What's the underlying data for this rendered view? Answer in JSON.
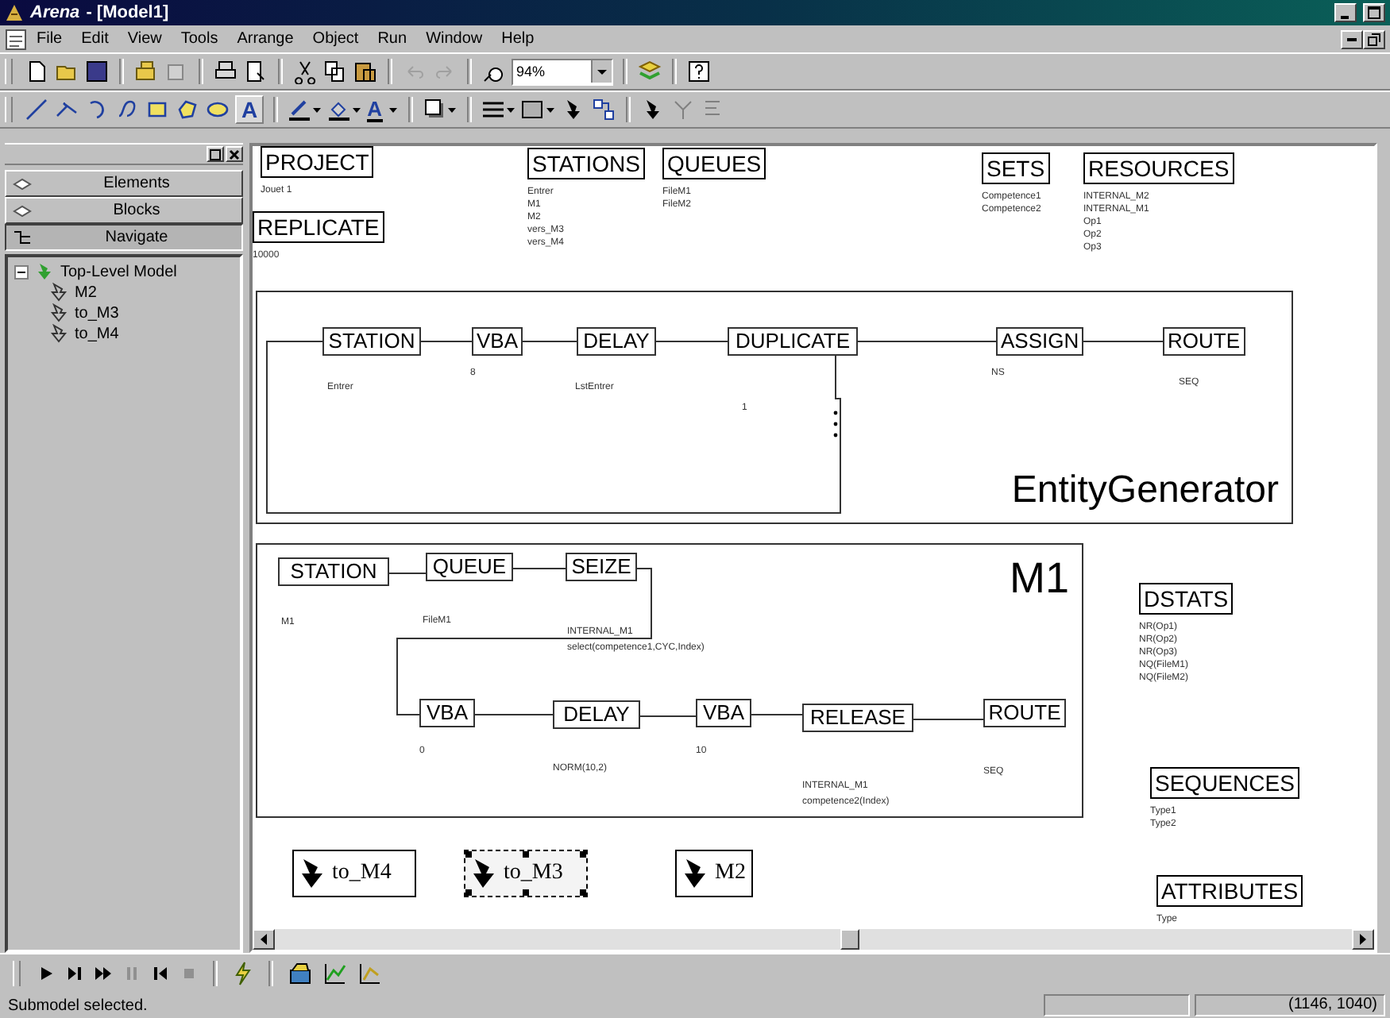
{
  "window": {
    "title": "Arena",
    "document": "- [Model1]"
  },
  "menu": [
    "File",
    "Edit",
    "View",
    "Tools",
    "Arrange",
    "Object",
    "Run",
    "Window",
    "Help"
  ],
  "toolbar": {
    "zoom": "94%"
  },
  "drawing_toolbar": {
    "text_tool": "A",
    "font_color": "A"
  },
  "project_bar": {
    "tabs": [
      {
        "label": "Elements",
        "selected": false
      },
      {
        "label": "Blocks",
        "selected": false
      },
      {
        "label": "Navigate",
        "selected": true
      }
    ],
    "tree": [
      {
        "label": "Top-Level Model",
        "expanded": true,
        "children": [
          {
            "label": "M2"
          },
          {
            "label": "to_M3"
          },
          {
            "label": "to_M4"
          }
        ]
      }
    ]
  },
  "data_modules": [
    {
      "title": "PROJECT",
      "items": [
        "Jouet 1"
      ]
    },
    {
      "title": "REPLICATE",
      "items": [
        "10000"
      ]
    },
    {
      "title": "STATIONS",
      "items": [
        "Entrer",
        "M1",
        "M2",
        "vers_M3",
        "vers_M4"
      ]
    },
    {
      "title": "QUEUES",
      "items": [
        "FileM1",
        "FileM2"
      ]
    },
    {
      "title": "SETS",
      "items": [
        "Competence1",
        "Competence2"
      ]
    },
    {
      "title": "RESOURCES",
      "items": [
        "INTERNAL_M2",
        "INTERNAL_M1",
        "Op1",
        "Op2",
        "Op3"
      ]
    },
    {
      "title": "DSTATS",
      "items": [
        "NR(Op1)",
        "NR(Op2)",
        "NR(Op3)",
        "NQ(FileM1)",
        "NQ(FileM2)"
      ]
    },
    {
      "title": "SEQUENCES",
      "items": [
        "Type1",
        "Type2"
      ]
    },
    {
      "title": "ATTRIBUTES",
      "items": [
        "Type"
      ]
    }
  ],
  "submodels": [
    {
      "title": "EntityGenerator",
      "modules": [
        {
          "label": "STATION",
          "operands": [
            "Entrer"
          ]
        },
        {
          "label": "VBA",
          "operands": [
            "8"
          ]
        },
        {
          "label": "DELAY",
          "operands": [
            "LstEntrer"
          ]
        },
        {
          "label": "DUPLICATE",
          "operands": [
            "1"
          ]
        },
        {
          "label": "ASSIGN",
          "operands": [
            "NS"
          ]
        },
        {
          "label": "ROUTE",
          "operands": [
            "SEQ"
          ]
        }
      ]
    },
    {
      "title": "M1",
      "modules": [
        {
          "label": "STATION",
          "operands": [
            "M1"
          ]
        },
        {
          "label": "QUEUE",
          "operands": [
            "FileM1"
          ]
        },
        {
          "label": "SEIZE",
          "operands": [
            "INTERNAL_M1",
            "select(competence1,CYC,Index)"
          ]
        },
        {
          "label": "VBA",
          "operands": [
            "0"
          ]
        },
        {
          "label": "DELAY",
          "operands": [
            "NORM(10,2)"
          ]
        },
        {
          "label": "VBA",
          "operands": [
            "10"
          ]
        },
        {
          "label": "RELEASE",
          "operands": [
            "INTERNAL_M1",
            "competence2(Index)"
          ]
        },
        {
          "label": "ROUTE",
          "operands": [
            "SEQ"
          ]
        }
      ]
    }
  ],
  "submodel_icons": [
    {
      "label": "to_M4",
      "selected": false
    },
    {
      "label": "to_M3",
      "selected": true
    },
    {
      "label": "M2",
      "selected": false
    }
  ],
  "status_bar": {
    "message": "Submodel selected.",
    "coordinates": "(1146, 1040)"
  }
}
